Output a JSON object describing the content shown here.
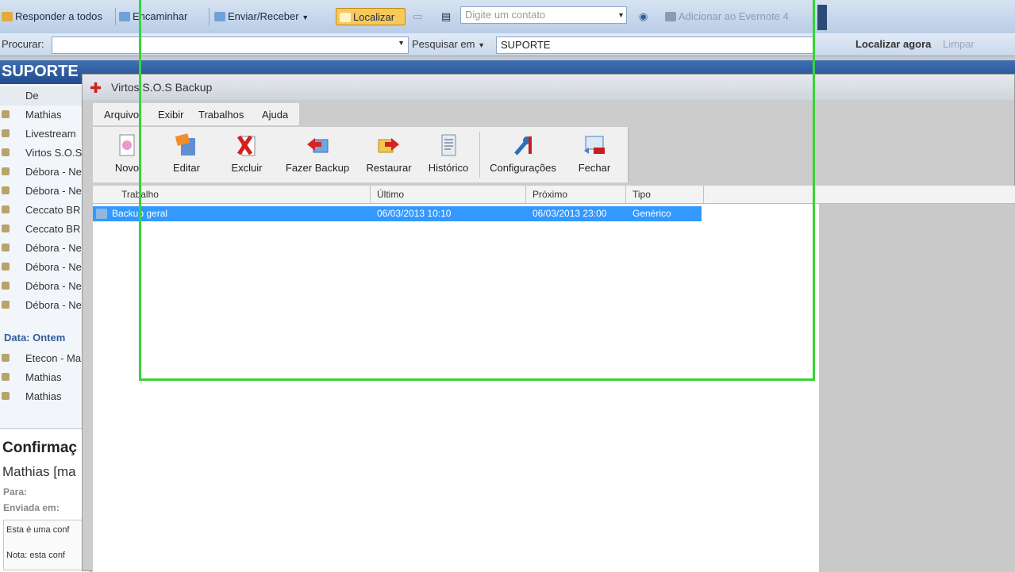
{
  "outlook": {
    "toolbar": {
      "reply_all": "Responder a todos",
      "forward": "Encaminhar",
      "send_receive": "Enviar/Receber",
      "find": "Localizar",
      "contact_placeholder": "Digite um contato",
      "evernote": "Adicionar ao Evernote 4"
    },
    "search": {
      "label": "Procurar:",
      "search_in": "Pesquisar em",
      "search_in_value": "SUPORTE",
      "find_now": "Localizar agora",
      "clear": "Limpar"
    },
    "folder_title": "SUPORTE",
    "list_header": "De",
    "mail_items": [
      "Mathias",
      "Livestream",
      "Virtos S.O.S",
      "Débora - Ne",
      "Débora - Ne",
      "Ceccato BR",
      "Ceccato BR",
      "Débora - Ne",
      "Débora - Ne",
      "Débora - Ne",
      "Débora - Ne"
    ],
    "group_yesterday": "Data: Ontem",
    "yesterday_items": [
      "Etecon - Ma",
      "Mathias",
      "Mathias"
    ],
    "reading": {
      "subject": "Confirmaç",
      "from": "Mathias [ma",
      "to_label": "Para:",
      "sent_label": "Enviada em:",
      "body_line1": "Esta é uma conf",
      "body_line2": "Nota: esta conf"
    }
  },
  "app": {
    "title": "Virtos S.O.S Backup",
    "menu": [
      "Arquivo",
      "Exibir",
      "Trabalhos",
      "Ajuda"
    ],
    "toolbar": [
      {
        "label": "Novo",
        "icon": "new-icon"
      },
      {
        "label": "Editar",
        "icon": "edit-icon"
      },
      {
        "label": "Excluir",
        "icon": "delete-icon"
      },
      {
        "label": "Fazer Backup",
        "icon": "backup-icon"
      },
      {
        "label": "Restaurar",
        "icon": "restore-icon"
      },
      {
        "label": "Histórico",
        "icon": "history-icon"
      },
      {
        "label": "Configurações",
        "icon": "settings-icon"
      },
      {
        "label": "Fechar",
        "icon": "close-icon"
      }
    ],
    "columns": [
      "Trabalho",
      "Último",
      "Próximo",
      "Tipo"
    ],
    "rows": [
      {
        "job": "Backup geral",
        "last": "06/03/2013 10:10",
        "next": "06/03/2013 23:00",
        "type": "Genérico"
      }
    ],
    "selection_color": "#3399ff"
  },
  "recording_frame_color": "#38d438"
}
